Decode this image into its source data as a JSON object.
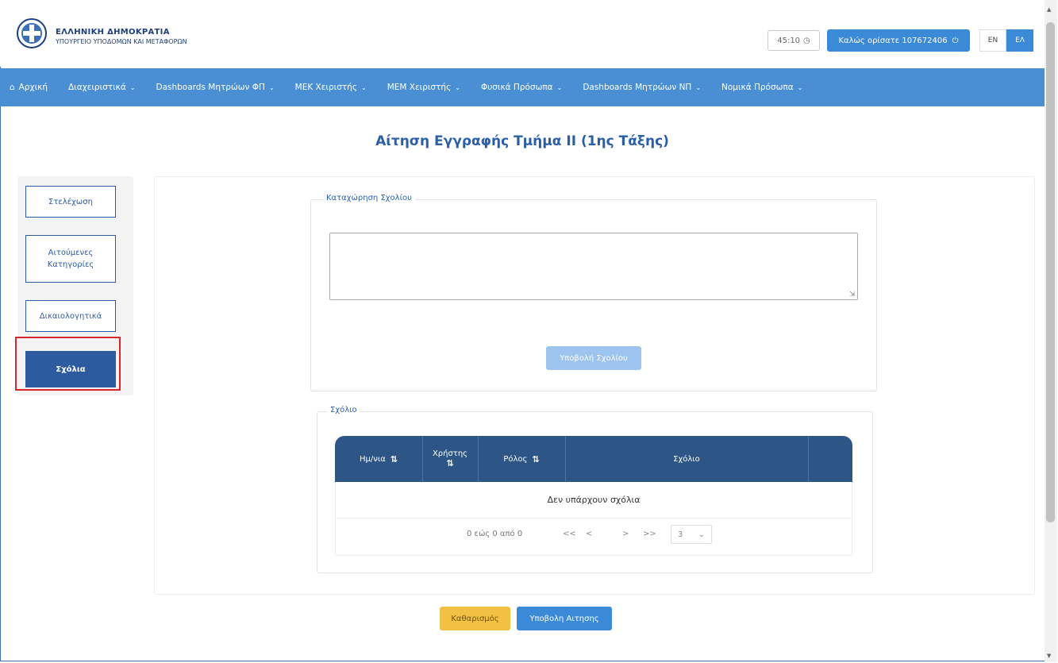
{
  "header": {
    "brand_title": "ΕΛΛΗΝΙΚΗ ΔΗΜΟΚΡΑΤΙΑ",
    "brand_subtitle": "ΥΠΟΥΡΓΕΙΟ ΥΠΟΔΟΜΩΝ ΚΑΙ ΜΕΤΑΦΟΡΩΝ",
    "timer": "45:10",
    "welcome": "Καλώς ορίσατε 107672406",
    "lang_en": "EN",
    "lang_el": "ΕΛ"
  },
  "nav": {
    "items": [
      {
        "label": "Αρχική",
        "icon": "home-icon"
      },
      {
        "label": "Διαχειριστικά"
      },
      {
        "label": "Dashboards Μητρώων ΦΠ"
      },
      {
        "label": "ΜΕΚ Χειριστής"
      },
      {
        "label": "ΜΕΜ Χειριστής"
      },
      {
        "label": "Φυσικά Πρόσωπα"
      },
      {
        "label": "Dashboards Μητρώων ΝΠ"
      },
      {
        "label": "Νομικά Πρόσωπα"
      }
    ]
  },
  "page": {
    "title": "Αίτηση Εγγραφής Τμήμα ΙΙ (1ης Τάξης)"
  },
  "sidebar": {
    "items": [
      {
        "label": "Στελέχωση"
      },
      {
        "label": "Αιτούμενες Κατηγορίες"
      },
      {
        "label": "Δικαιολογητικά"
      },
      {
        "label": "Σχόλια",
        "active": true
      }
    ]
  },
  "comment_entry": {
    "legend": "Καταχώρηση Σχολίου",
    "text": "",
    "submit_label": "Υποβολή Σχολίου"
  },
  "comments": {
    "legend": "Σχόλιο",
    "columns": [
      "Ημ/νια",
      "Χρήστης",
      "Ρόλος",
      "Σχόλιο"
    ],
    "empty_message": "Δεν υπάρχουν σχόλια",
    "pager_text": "0 εώς 0 από 0",
    "first": "<<",
    "prev": "<",
    "next": ">",
    "last": ">>",
    "page_size": "3"
  },
  "actions": {
    "clear_label": "Καθαρισμός",
    "submit_label": "Υποβολη Αιτησης"
  },
  "colors": {
    "nav_bg": "#4a8fd4",
    "primary": "#3b8ad8",
    "table_header": "#2d5687",
    "highlight": "#d9232d",
    "clear_button": "#f2c043"
  }
}
